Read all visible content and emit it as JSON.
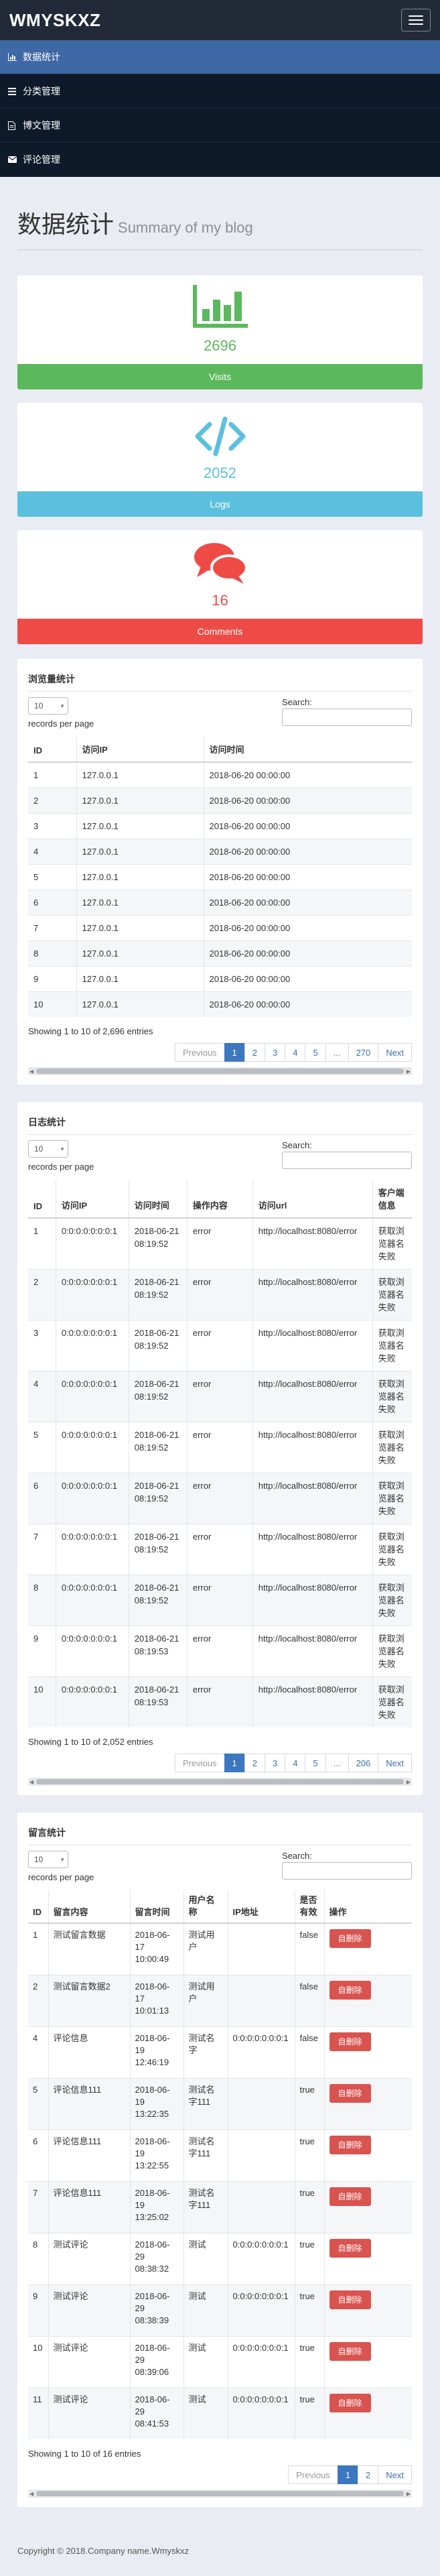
{
  "brand": "WMYSKXZ",
  "nav": [
    {
      "label": "数据统计",
      "icon": "bar-chart-icon",
      "active": true
    },
    {
      "label": "分类管理",
      "icon": "list-icon",
      "active": false
    },
    {
      "label": "博文管理",
      "icon": "file-icon",
      "active": false
    },
    {
      "label": "评论管理",
      "icon": "envelope-icon",
      "active": false
    }
  ],
  "page": {
    "title": "数据统计",
    "subtitle": "Summary of my blog"
  },
  "stats": [
    {
      "icon": "bar-chart-icon",
      "value": "2696",
      "label": "Visits",
      "color": "#5cb85c"
    },
    {
      "icon": "code-icon",
      "value": "2052",
      "label": "Logs",
      "color": "#5bc0de"
    },
    {
      "icon": "comments-icon",
      "value": "16",
      "label": "Comments",
      "color": "#ef4b46"
    }
  ],
  "common": {
    "page_length": "10",
    "records_label": "records per page",
    "search_label": "Search:",
    "prev": "Previous",
    "next": "Next",
    "delete_label": "自删除"
  },
  "visits": {
    "title": "浏览量统计",
    "columns": [
      "ID",
      "访问IP",
      "访问时间"
    ],
    "rows": [
      [
        "1",
        "127.0.0.1",
        "2018-06-20 00:00:00"
      ],
      [
        "2",
        "127.0.0.1",
        "2018-06-20 00:00:00"
      ],
      [
        "3",
        "127.0.0.1",
        "2018-06-20 00:00:00"
      ],
      [
        "4",
        "127.0.0.1",
        "2018-06-20 00:00:00"
      ],
      [
        "5",
        "127.0.0.1",
        "2018-06-20 00:00:00"
      ],
      [
        "6",
        "127.0.0.1",
        "2018-06-20 00:00:00"
      ],
      [
        "7",
        "127.0.0.1",
        "2018-06-20 00:00:00"
      ],
      [
        "8",
        "127.0.0.1",
        "2018-06-20 00:00:00"
      ],
      [
        "9",
        "127.0.0.1",
        "2018-06-20 00:00:00"
      ],
      [
        "10",
        "127.0.0.1",
        "2018-06-20 00:00:00"
      ]
    ],
    "info": "Showing 1 to 10 of 2,696 entries",
    "pages": [
      "1",
      "2",
      "3",
      "4",
      "5",
      "...",
      "270"
    ]
  },
  "logs": {
    "title": "日志统计",
    "columns": [
      "ID",
      "访问IP",
      "访问时间",
      "操作内容",
      "访问url",
      "客户端信息"
    ],
    "rows": [
      [
        "1",
        "0:0:0:0:0:0:0:1",
        "2018-06-21 08:19:52",
        "error",
        "http://localhost:8080/error",
        "获取浏览器名失败"
      ],
      [
        "2",
        "0:0:0:0:0:0:0:1",
        "2018-06-21 08:19:52",
        "error",
        "http://localhost:8080/error",
        "获取浏览器名失败"
      ],
      [
        "3",
        "0:0:0:0:0:0:0:1",
        "2018-06-21 08:19:52",
        "error",
        "http://localhost:8080/error",
        "获取浏览器名失败"
      ],
      [
        "4",
        "0:0:0:0:0:0:0:1",
        "2018-06-21 08:19:52",
        "error",
        "http://localhost:8080/error",
        "获取浏览器名失败"
      ],
      [
        "5",
        "0:0:0:0:0:0:0:1",
        "2018-06-21 08:19:52",
        "error",
        "http://localhost:8080/error",
        "获取浏览器名失败"
      ],
      [
        "6",
        "0:0:0:0:0:0:0:1",
        "2018-06-21 08:19:52",
        "error",
        "http://localhost:8080/error",
        "获取浏览器名失败"
      ],
      [
        "7",
        "0:0:0:0:0:0:0:1",
        "2018-06-21 08:19:52",
        "error",
        "http://localhost:8080/error",
        "获取浏览器名失败"
      ],
      [
        "8",
        "0:0:0:0:0:0:0:1",
        "2018-06-21 08:19:52",
        "error",
        "http://localhost:8080/error",
        "获取浏览器名失败"
      ],
      [
        "9",
        "0:0:0:0:0:0:0:1",
        "2018-06-21 08:19:53",
        "error",
        "http://localhost:8080/error",
        "获取浏览器名失败"
      ],
      [
        "10",
        "0:0:0:0:0:0:0:1",
        "2018-06-21 08:19:53",
        "error",
        "http://localhost:8080/error",
        "获取浏览器名失败"
      ]
    ],
    "info": "Showing 1 to 10 of 2,052 entries",
    "pages": [
      "1",
      "2",
      "3",
      "4",
      "5",
      "...",
      "206"
    ]
  },
  "comments": {
    "title": "留言统计",
    "columns": [
      "ID",
      "留言内容",
      "留言时间",
      "用户名称",
      "IP地址",
      "是否有效",
      "操作"
    ],
    "rows": [
      [
        "1",
        "测试留言数据",
        "2018-06-17 10:00:49",
        "测试用户",
        "",
        "false"
      ],
      [
        "2",
        "测试留言数据2",
        "2018-06-17 10:01:13",
        "测试用户",
        "",
        "false"
      ],
      [
        "4",
        "评论信息",
        "2018-06-19 12:46:19",
        "测试名字",
        "0:0:0:0:0:0:0:1",
        "false"
      ],
      [
        "5",
        "评论信息111",
        "2018-06-19 13:22:35",
        "测试名字111",
        "",
        "true"
      ],
      [
        "6",
        "评论信息111",
        "2018-06-19 13:22:55",
        "测试名字111",
        "",
        "true"
      ],
      [
        "7",
        "评论信息111",
        "2018-06-19 13:25:02",
        "测试名字111",
        "",
        "true"
      ],
      [
        "8",
        "测试评论",
        "2018-06-29 08:38:32",
        "测试",
        "0:0:0:0:0:0:0:1",
        "true"
      ],
      [
        "9",
        "测试评论",
        "2018-06-29 08:38:39",
        "测试",
        "0:0:0:0:0:0:0:1",
        "true"
      ],
      [
        "10",
        "测试评论",
        "2018-06-29 08:39:06",
        "测试",
        "0:0:0:0:0:0:0:1",
        "true"
      ],
      [
        "11",
        "测试评论",
        "2018-06-29 08:41:53",
        "测试",
        "0:0:0:0:0:0:0:1",
        "true"
      ]
    ],
    "info": "Showing 1 to 10 of 16 entries",
    "pages": [
      "1",
      "2"
    ]
  },
  "footer": "Copyright © 2018.Company name.Wmyskxz"
}
